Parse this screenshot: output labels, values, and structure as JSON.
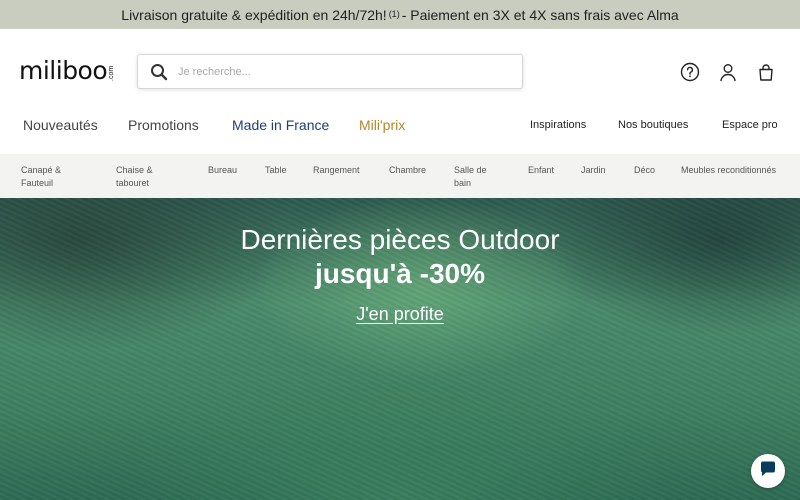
{
  "announcement": {
    "text_before": "Livraison gratuite & expédition en 24h/72h!",
    "footnote": "(1)",
    "text_after": "- Paiement en 3X et 4X sans frais avec Alma"
  },
  "header": {
    "logo_word": "miliboo",
    "logo_suffix": ".com",
    "search_placeholder": "Je recherche...",
    "icons": [
      "help-icon",
      "user-icon",
      "bag-icon"
    ]
  },
  "main_nav": [
    {
      "label": "Nouveautés",
      "color": "#444444"
    },
    {
      "label": "Promotions",
      "color": "#444444"
    },
    {
      "label": "Made in France",
      "color": "#1e3f7a"
    },
    {
      "label": "Mili'prix",
      "color": "#b5862a"
    }
  ],
  "secondary_nav": [
    {
      "label": "Inspirations"
    },
    {
      "label": "Nos boutiques"
    },
    {
      "label": "Espace pro"
    }
  ],
  "categories": [
    {
      "line1": "Canapé &",
      "line2": "Fauteuil"
    },
    {
      "line1": "Chaise &",
      "line2": "tabouret"
    },
    {
      "line1": "Bureau",
      "line2": ""
    },
    {
      "line1": "Table",
      "line2": ""
    },
    {
      "line1": "Rangement",
      "line2": ""
    },
    {
      "line1": "Chambre",
      "line2": ""
    },
    {
      "line1": "Salle de",
      "line2": "bain"
    },
    {
      "line1": "Enfant",
      "line2": ""
    },
    {
      "line1": "Jardin",
      "line2": ""
    },
    {
      "line1": "Déco",
      "line2": ""
    },
    {
      "line1": "Meubles reconditionnés",
      "line2": ""
    }
  ],
  "hero": {
    "title": "Dernières pièces Outdoor",
    "subtitle": "jusqu'à -30%",
    "cta": "J'en profite"
  },
  "colors": {
    "announcement_bg": "#c9cdc0",
    "category_bar_bg": "#f3f3f1",
    "made_in_france": "#1e3f7a",
    "miliprix": "#b5862a"
  }
}
